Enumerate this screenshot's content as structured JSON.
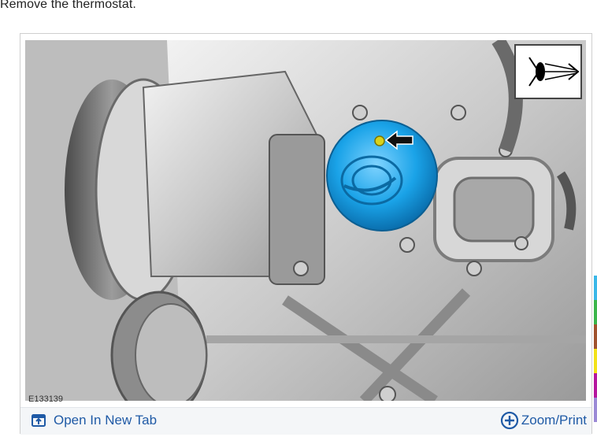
{
  "step": {
    "text": "Remove the thermostat."
  },
  "figure": {
    "code": "E133139",
    "open_tab_label": "Open In New Tab",
    "zoom_label": "Zoom/Print",
    "icons": {
      "open_tab": "open-in-new-tab-icon",
      "zoom": "zoom-plus-icon",
      "view": "eye-view-icon",
      "pointer": "arrow-pointer-icon"
    },
    "colors": {
      "link": "#1f5aa6",
      "thermostat": "#1aa3e8",
      "bolt": "#d9d21a"
    }
  },
  "edge_strip": {
    "colors": [
      "#3ab7e8",
      "#3bb54a",
      "#a0522d",
      "#f2e21a",
      "#b5179e",
      "#9b8ad6"
    ]
  }
}
